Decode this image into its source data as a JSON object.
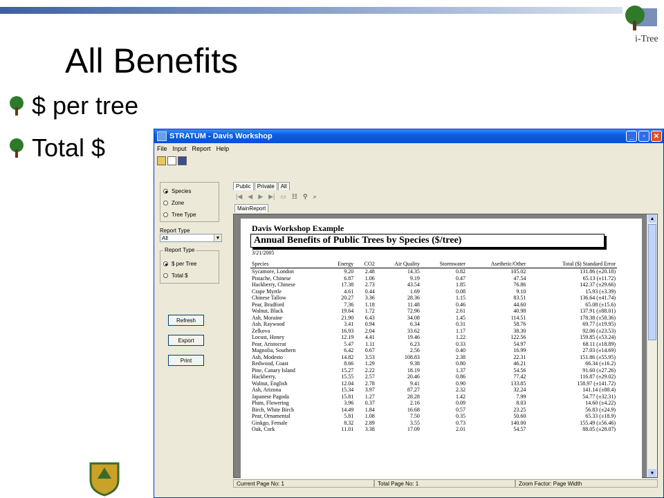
{
  "slide": {
    "title": "All Benefits",
    "bullets": [
      "$ per tree",
      "Total $"
    ],
    "logo_text": "i-Tree"
  },
  "window": {
    "title": "STRATUM - Davis Workshop",
    "menu": [
      "File",
      "Input",
      "Report",
      "Help"
    ],
    "view_options": [
      "Species",
      "Zone",
      "Tree Type"
    ],
    "view_selected": "Species",
    "report_type_label": "Report Type",
    "report_type_value": "All",
    "report_type_group_label": "Report Type",
    "report_type_options": [
      "$ per Tree",
      "Total $"
    ],
    "report_type_selected": "$ per Tree",
    "buttons": {
      "refresh": "Refresh",
      "export": "Export",
      "print": "Print"
    },
    "tabs": [
      "Public",
      "Private",
      "All"
    ],
    "active_tab": "Public",
    "subtab": "MainReport",
    "status": {
      "current_page": "Current Page No: 1",
      "total_page": "Total Page No: 1",
      "zoom": "Zoom Factor: Page Width"
    }
  },
  "report": {
    "heading": "Davis Workshop Example",
    "title": "Annual Benefits of Public Trees by Species ($/tree)",
    "date": "3/21/2005",
    "columns": [
      "Species",
      "Energy",
      "CO2",
      "Air Quality",
      "Stormwater",
      "Asethetic/Other",
      "Total ($) Standard Error"
    ],
    "rows": [
      [
        "Sycamore, London",
        "9.20",
        "2.48",
        "14.35",
        "0.82",
        "105.02",
        "131.86 (±20.18)"
      ],
      [
        "Pistache, Chinese",
        "6.87",
        "1.06",
        "9.19",
        "0.47",
        "47.54",
        "65.13 (±11.72)"
      ],
      [
        "Hackberry, Chinese",
        "17.38",
        "2.73",
        "43.54",
        "1.85",
        "76.86",
        "142.37 (±29.66)"
      ],
      [
        "Crape Myrtle",
        "4.61",
        "0.44",
        "1.69",
        "0.08",
        "9.10",
        "15.93 (±3.39)"
      ],
      [
        "Chinese Tallow",
        "20.27",
        "3.36",
        "28.36",
        "1.15",
        "83.51",
        "136.64 (±41.74)"
      ],
      [
        "Pear, Bradford",
        "7.36",
        "1.18",
        "11.48",
        "0.46",
        "44.60",
        "65.08 (±15.6)"
      ],
      [
        "Walnut, Black",
        "19.64",
        "1.72",
        "72.96",
        "2.61",
        "40.98",
        "137.91 (±88.01)"
      ],
      [
        "Ash, Moraine",
        "21.90",
        "6.43",
        "34.08",
        "1.45",
        "114.51",
        "178.38 (±58.36)"
      ],
      [
        "Ash, Raywood",
        "3.41",
        "0.94",
        "6.34",
        "0.31",
        "58.76",
        "69.77 (±19.95)"
      ],
      [
        "Zelkova",
        "16.93",
        "2.04",
        "33.62",
        "1.17",
        "38.30",
        "92.06 (±23.53)"
      ],
      [
        "Locust, Honey",
        "12.19",
        "4.41",
        "19.46",
        "1.22",
        "122.56",
        "159.85 (±53.24)"
      ],
      [
        "Pear, Aristocrat",
        "5.47",
        "1.11",
        "6.23",
        "0.33",
        "54.97",
        "68.11 (±18.89)"
      ],
      [
        "Magnolia, Southern",
        "6.42",
        "0.67",
        "2.56",
        "0.40",
        "16.99",
        "27.03 (±14.69)"
      ],
      [
        "Ash, Modesto",
        "14.82",
        "3.53",
        "108.83",
        "2.38",
        "22.31",
        "151.86 (±55.95)"
      ],
      [
        "Redwood, Coast",
        "8.66",
        "1.29",
        "9.38",
        "0.80",
        "46.21",
        "66.34 (±16.2)"
      ],
      [
        "Pine, Canary Island",
        "15.27",
        "2.22",
        "18.19",
        "1.37",
        "54.56",
        "91.60 (±27.26)"
      ],
      [
        "Hackberry,",
        "15.55",
        "2.57",
        "20.46",
        "0.86",
        "77.42",
        "116.87 (±29.02)"
      ],
      [
        "Walnut, English",
        "12.04",
        "2.78",
        "9.41",
        "0.90",
        "133.85",
        "158.97 (±141.72)"
      ],
      [
        "Ash, Arizona",
        "15.34",
        "3.97",
        "87.27",
        "2.32",
        "32.24",
        "141.14 (±88.4)"
      ],
      [
        "Japanese Pagoda",
        "15.81",
        "1.27",
        "28.28",
        "1.42",
        "7.99",
        "54.77 (±32.31)"
      ],
      [
        "Plum, Flowering",
        "3.96",
        "0.37",
        "2.16",
        "0.09",
        "8.03",
        "14.60 (±4.22)"
      ],
      [
        "Birch, White Birch",
        "14.49",
        "1.84",
        "16.68",
        "0.57",
        "23.25",
        "56.83 (±24.9)"
      ],
      [
        "Pear, Ornamental",
        "5.81",
        "1.08",
        "7.50",
        "0.35",
        "50.60",
        "65.33 (±18.9)"
      ],
      [
        "Ginkgo, Female",
        "8.32",
        "2.89",
        "3.55",
        "0.73",
        "140.00",
        "155.49 (±56.46)"
      ],
      [
        "Oak, Cork",
        "11.01",
        "3.38",
        "17.09",
        "2.01",
        "54.57",
        "88.05 (±28.07)"
      ]
    ]
  }
}
